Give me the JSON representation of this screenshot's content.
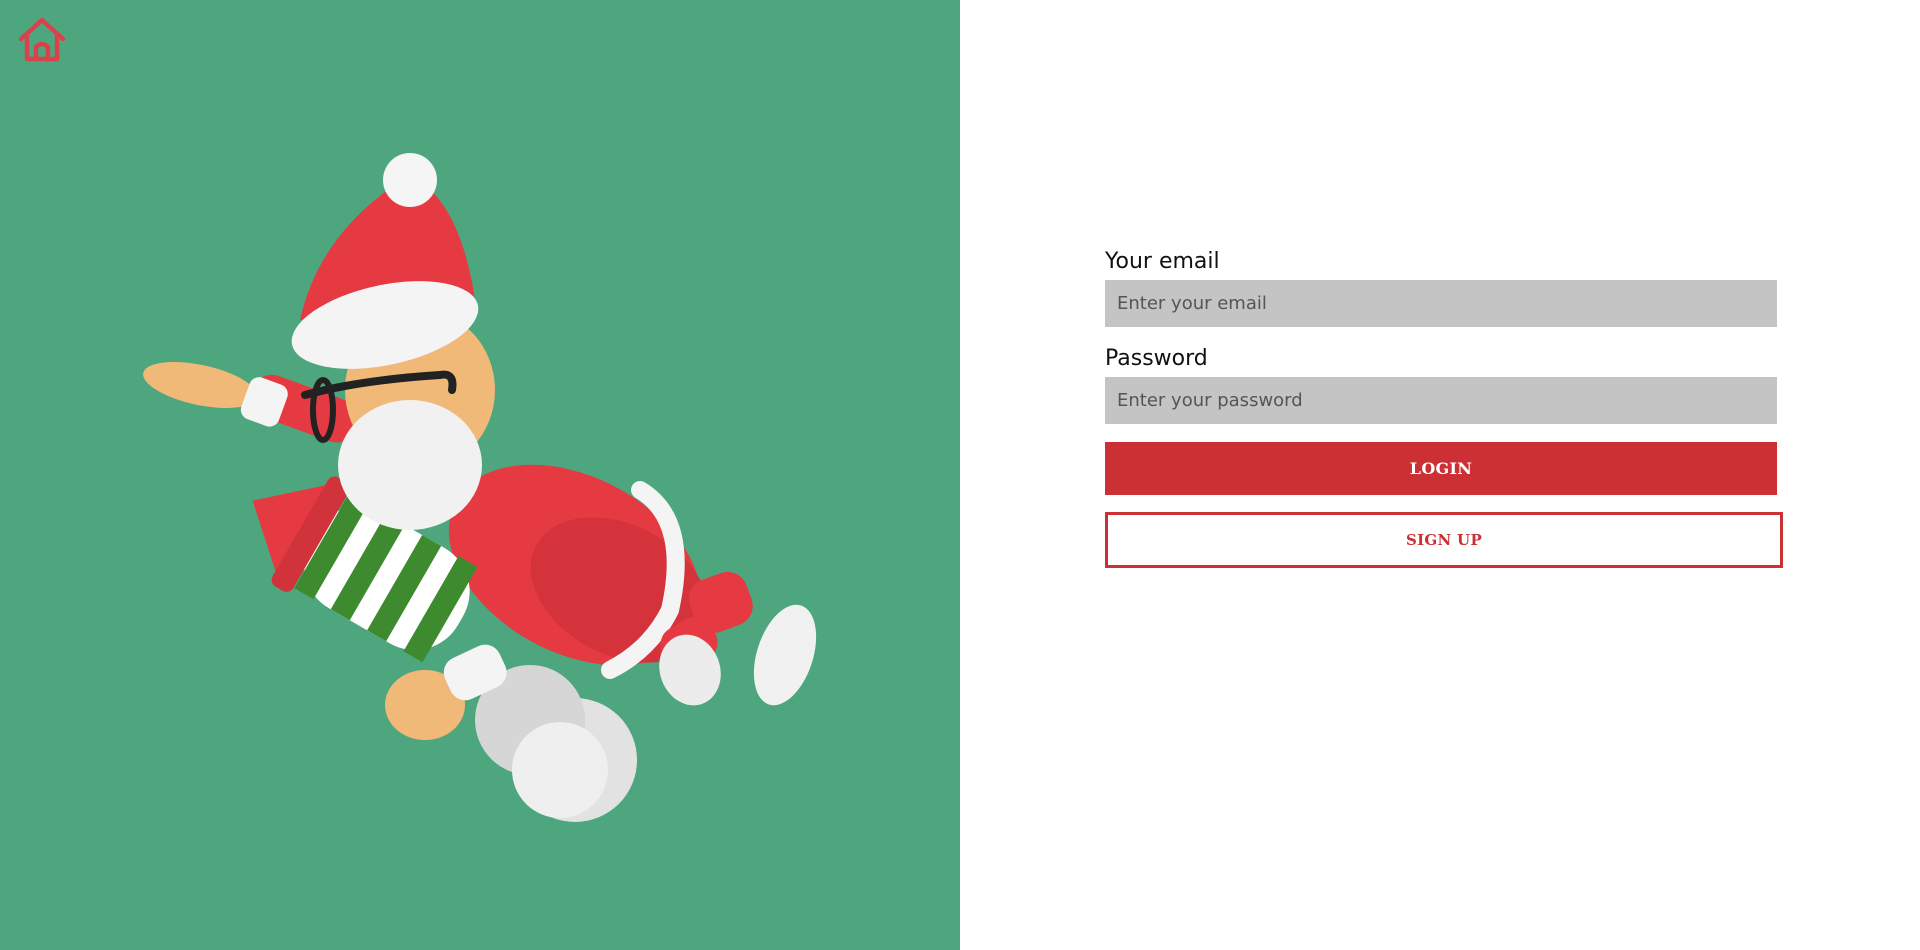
{
  "nav": {
    "home_icon": "home-icon",
    "home_color": "#d9414c"
  },
  "hero": {
    "background_color": "#4ea67e",
    "illustration": "santa-riding-rocket-illustration"
  },
  "login_form": {
    "email": {
      "label": "Your email",
      "placeholder": "Enter your email",
      "value": ""
    },
    "password": {
      "label": "Password",
      "placeholder": "Enter your password",
      "value": ""
    },
    "login_button": "LOGIN",
    "signup_button": "SIGN UP",
    "accent_color": "#cc3035",
    "input_background": "#c4c4c4"
  }
}
